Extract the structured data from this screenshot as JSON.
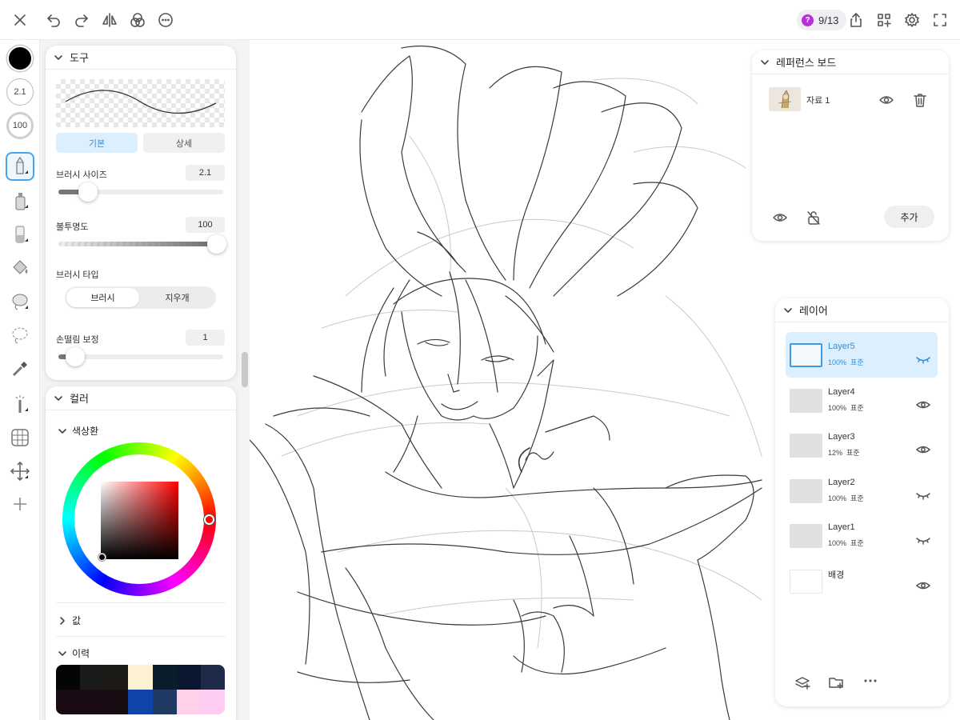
{
  "topbar": {
    "left_icons": [
      "close-icon",
      "undo-icon",
      "redo-icon",
      "flip-icon",
      "blend-icon",
      "more-icon"
    ],
    "page_counter": "9/13",
    "help_badge": "?",
    "right_icons": [
      "share-icon",
      "add-widget-icon",
      "settings-icon",
      "fullscreen-icon"
    ]
  },
  "rail": {
    "current_color": "#000000",
    "brush_size": "2.1",
    "brush_opacity": "100",
    "tools": [
      "pen-icon",
      "airbrush-icon",
      "blur-icon",
      "fill-icon",
      "lasso-icon",
      "selection-icon",
      "eyedropper-icon",
      "magic-wand-icon",
      "grid-icon",
      "move-icon",
      "add-icon"
    ]
  },
  "tool_panel": {
    "title": "도구",
    "tab_basic": "기본",
    "tab_detail": "상세",
    "brush_size_label": "브러시 사이즈",
    "brush_size_value": "2.1",
    "brush_size_level": 0.18,
    "opacity_label": "불투명도",
    "opacity_value": "100",
    "opacity_level": 1.0,
    "brush_type_label": "브러시 타입",
    "brush_type_brush": "브러시",
    "brush_type_eraser": "지우개",
    "stabilizer_label": "손떨림 보정",
    "stabilizer_value": "1",
    "stabilizer_level": 0.1
  },
  "color_panel": {
    "title": "컬러",
    "color_wheel_label": "색상환",
    "value_label": "값",
    "history_label": "이력",
    "history_colors": [
      "#050505",
      "#1a1a1a",
      "#1d1b16",
      "#fdf1d3",
      "#0a1c2c",
      "#0b1730",
      "#1d2a4a",
      "#1a0a14",
      "#190a15",
      "#180b12",
      "#0f45a8",
      "#213a63",
      "#ffd0ea",
      "#ffcdf2"
    ]
  },
  "reference_board": {
    "title": "레퍼런스 보드",
    "item_label": "자료 1",
    "add_label": "추가"
  },
  "layers": {
    "title": "레이어",
    "items": [
      {
        "name": "Layer5",
        "opacity": "100%",
        "blend": "표준",
        "visible": false,
        "selected": true
      },
      {
        "name": "Layer4",
        "opacity": "100%",
        "blend": "표준",
        "visible": true,
        "selected": false
      },
      {
        "name": "Layer3",
        "opacity": "12%",
        "blend": "표준",
        "visible": true,
        "selected": false
      },
      {
        "name": "Layer2",
        "opacity": "100%",
        "blend": "표준",
        "visible": false,
        "selected": false
      },
      {
        "name": "Layer1",
        "opacity": "100%",
        "blend": "표준",
        "visible": false,
        "selected": false
      },
      {
        "name": "배경",
        "opacity": "",
        "blend": "",
        "visible": true,
        "selected": false
      }
    ],
    "footer_icons": [
      "add-layer-icon",
      "add-folder-icon",
      "more-icon"
    ]
  },
  "colors": {
    "accent": "#2f8fdc",
    "selection_bg": "#dbefff"
  }
}
